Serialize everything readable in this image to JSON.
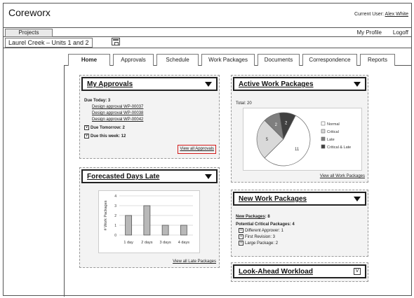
{
  "app": {
    "title": "Coreworx"
  },
  "user": {
    "label": "Current User:",
    "name": "Alex White"
  },
  "menu": {
    "projects": "Projects",
    "my_profile": "My Profile",
    "logoff": "Logoff"
  },
  "project": {
    "name": "Laurel Creek – Units 1 and 2"
  },
  "tabs": [
    {
      "label": "Home"
    },
    {
      "label": "Approvals"
    },
    {
      "label": "Schedule"
    },
    {
      "label": "Work Packages"
    },
    {
      "label": "Documents"
    },
    {
      "label": "Correspondence"
    },
    {
      "label": "Reports"
    }
  ],
  "approvals": {
    "title": "My Approvals",
    "due_today": "Due Today: 3",
    "items": [
      "Design approval WP-00037",
      "Design approval WP-00038",
      "Design approval WP-00042"
    ],
    "check_mark": "V",
    "due_tomorrow": "Due Tomorrow: 2",
    "due_week": "Due this week: 12",
    "view_all": "View all Approvals"
  },
  "forecast": {
    "title": "Forecasted Days Late",
    "view_all": "View all Late Packages"
  },
  "chart_data": [
    {
      "type": "bar",
      "categories": [
        "1 day",
        "2 days",
        "3 days",
        "4 days"
      ],
      "values": [
        2,
        3,
        1,
        1
      ],
      "xlabel": "",
      "ylabel": "# Work Packages",
      "ylim": [
        0,
        4
      ],
      "yticks": [
        "0",
        "1",
        "2",
        "3",
        "4"
      ],
      "grid": true
    },
    {
      "type": "pie",
      "total_label": "Total: 20",
      "slices": [
        {
          "name": "Normal",
          "value": 11,
          "color": "#ffffff"
        },
        {
          "name": "Critical",
          "value": 5,
          "color": "#d9d9d9"
        },
        {
          "name": "Late",
          "value": 2,
          "color": "#7f7f7f"
        },
        {
          "name": "Critical & Late",
          "value": 2,
          "color": "#404040"
        }
      ],
      "legend_position": "right"
    }
  ],
  "active": {
    "title": "Active Work Packages",
    "view_all": "View all Work Packages"
  },
  "newwp": {
    "title": "New Work Packages",
    "new_label": "New Packages",
    "new_count": ": 8",
    "potential": "Potential Critical Packages: 4",
    "items": [
      "Different Approver: 1",
      "First Revision: 3",
      "Large Package: 2"
    ]
  },
  "lookahead": {
    "title": "Look-Ahead Workload",
    "check_mark": "V"
  }
}
